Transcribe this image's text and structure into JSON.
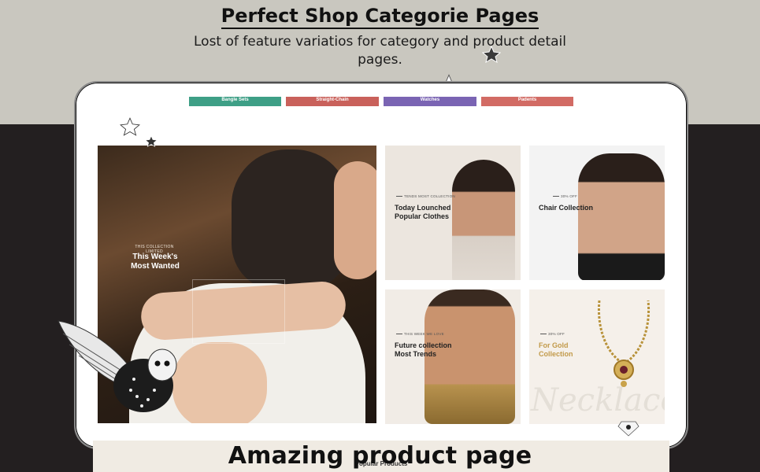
{
  "header": {
    "title": "Perfect Shop Categorie Pages",
    "subtitle": "Lost of feature variatios for category and product detail pages."
  },
  "categories": [
    {
      "label": "Bangle Sets",
      "color": "#3e9f86"
    },
    {
      "label": "Straight-Chain",
      "color": "#c9615b"
    },
    {
      "label": "Watches",
      "color": "#7a64b3"
    },
    {
      "label": "Padents",
      "color": "#d26b64"
    }
  ],
  "banners": {
    "main": {
      "tag": "THIS COLLECTION LIMITED",
      "title_line1": "This Week's",
      "title_line2": "Most Wanted"
    },
    "card1": {
      "tag": "TENDS MOST COLLECTION",
      "title_line1": "Today Lounched",
      "title_line2": "Popular Clothes"
    },
    "card2": {
      "tag": "30% OFF",
      "title_line1": "Chair Collection"
    },
    "card3": {
      "tag": "THIS WEEK WE LOVE",
      "title_line1": "Future collection",
      "title_line2": "Most Trends"
    },
    "card4": {
      "tag": "30% OFF",
      "title_line1": "For Gold",
      "title_line2": "Collection",
      "script_word": "Necklace"
    }
  },
  "section": {
    "popular": "Popular Products"
  },
  "footer": {
    "caption": "Amazing product page"
  },
  "icons": [
    "star-icon",
    "owl-icon",
    "diamond-icon"
  ]
}
